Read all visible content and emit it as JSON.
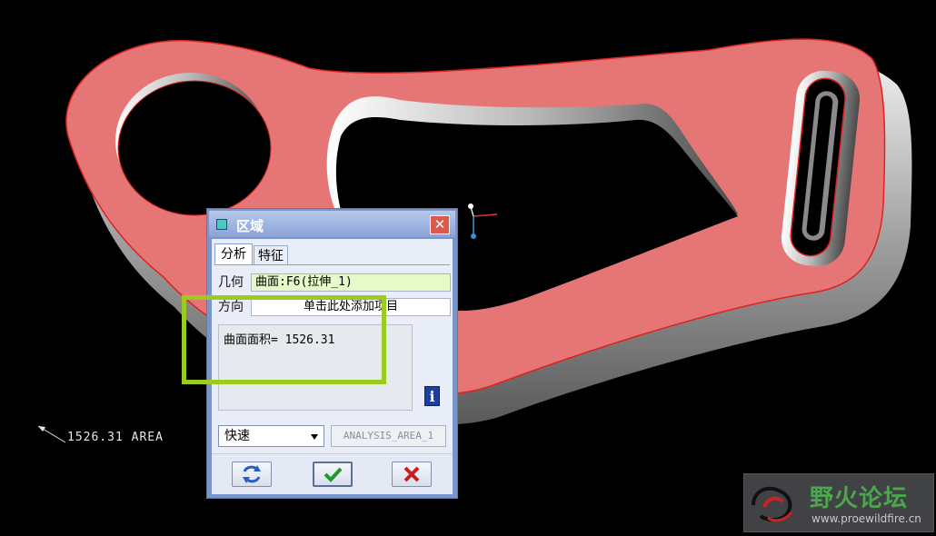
{
  "viewport": {
    "area_annotation": "1526.31 AREA"
  },
  "dialog": {
    "title": "区域",
    "close_symbol": "✕",
    "tabs": [
      {
        "label": "分析",
        "active": true
      },
      {
        "label": "特征",
        "active": false
      }
    ],
    "geometry_label": "几何",
    "geometry_value": "曲面:F6(拉伸_1)",
    "direction_label": "方向",
    "direction_value": "单击此处添加项目",
    "result_text": "曲面面积= 1526.31",
    "info_symbol": "i",
    "mode_select": "快速",
    "analysis_name": "ANALYSIS_AREA_1"
  },
  "watermark": {
    "title": "野火论坛",
    "url": "www.proewildfire.cn"
  },
  "colors": {
    "part_face": "#e67575",
    "part_side": "#8c8c8c",
    "highlight": "#9acb1e",
    "dialog_frame": "#7a95c9"
  }
}
